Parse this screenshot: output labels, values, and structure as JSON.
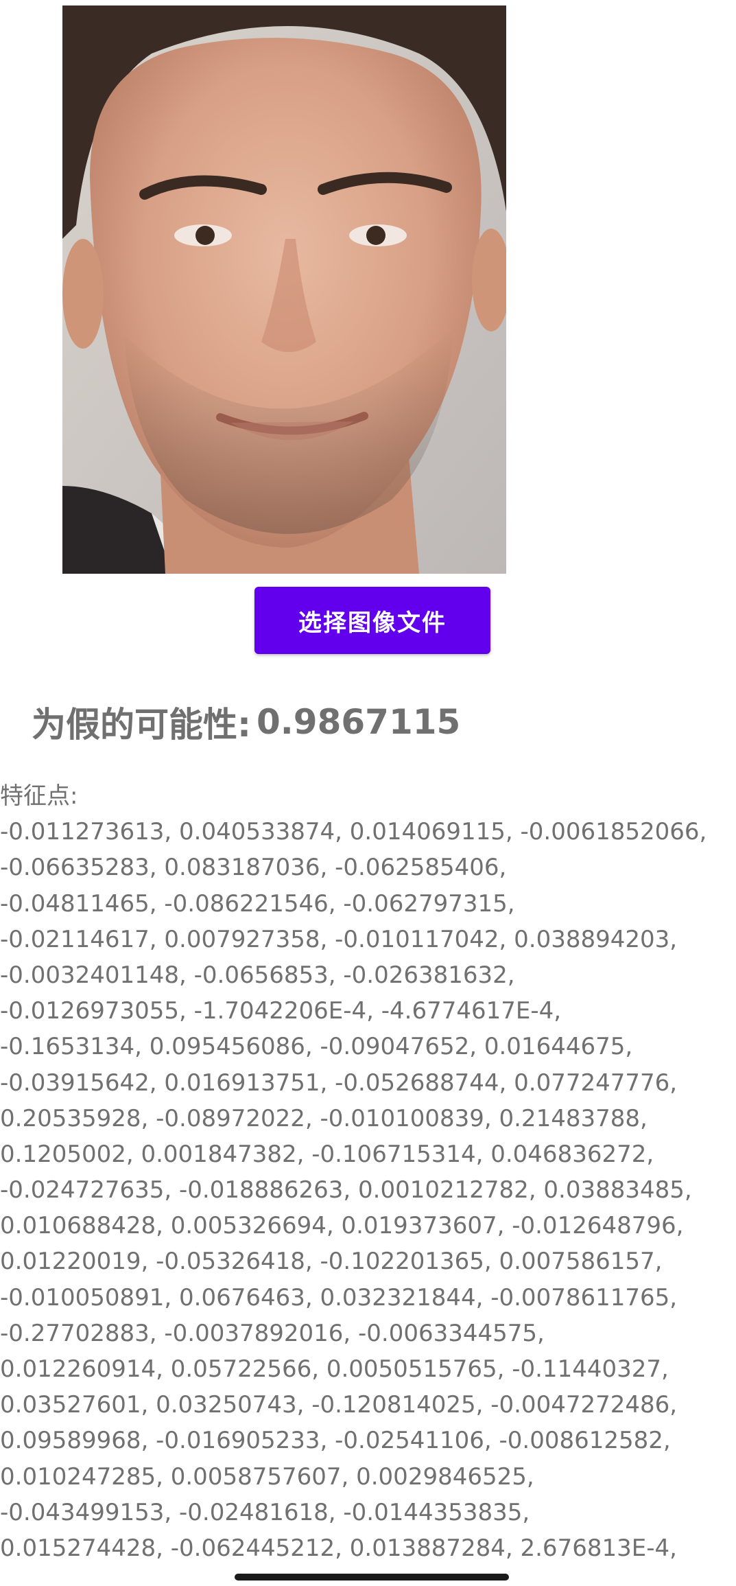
{
  "image": {
    "icon": "face-photo",
    "description_alt": "face photo"
  },
  "button": {
    "label": "选择图像文件"
  },
  "probability": {
    "label": "为假的可能性:",
    "value": "0.9867115"
  },
  "features": {
    "label": "特征点:",
    "lines": [
      "-0.011273613, 0.040533874, 0.014069115, -0.0061852066,",
      "-0.06635283, 0.083187036, -0.062585406,",
      "-0.04811465, -0.086221546, -0.062797315,",
      "-0.02114617, 0.007927358, -0.010117042, 0.038894203,",
      "-0.0032401148, -0.0656853, -0.026381632,",
      "-0.0126973055, -1.7042206E-4, -4.6774617E-4,",
      "-0.1653134, 0.095456086, -0.09047652, 0.01644675,",
      "-0.03915642, 0.016913751, -0.052688744, 0.077247776,",
      "0.20535928, -0.08972022, -0.010100839, 0.21483788,",
      "0.1205002, 0.001847382, -0.106715314, 0.046836272,",
      "-0.024727635, -0.018886263, 0.0010212782, 0.03883485,",
      "0.010688428, 0.005326694, 0.019373607, -0.012648796,",
      "0.01220019, -0.05326418, -0.102201365, 0.007586157,",
      "-0.010050891, 0.0676463, 0.032321844, -0.0078611765,",
      "-0.27702883, -0.0037892016, -0.0063344575,",
      "0.012260914, 0.05722566, 0.0050515765, -0.11440327,",
      "0.03527601, 0.03250743, -0.120814025, -0.0047272486,",
      "0.09589968, -0.016905233, -0.02541106, -0.008612582,",
      "0.010247285, 0.0058757607, 0.0029846525,",
      "-0.043499153, -0.02481618, -0.0144353835,",
      "0.015274428, -0.062445212, 0.013887284, 2.676813E-4,"
    ]
  },
  "colors": {
    "button_bg": "#6200ee",
    "button_text": "#ffffff",
    "text_gray": "#707070"
  }
}
